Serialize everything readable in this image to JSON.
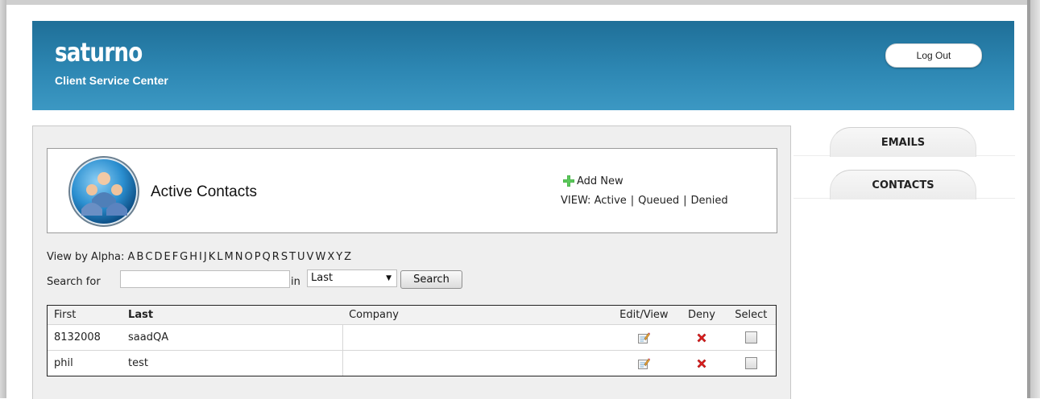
{
  "header": {
    "logo": "saturno",
    "subtitle": "Client Service Center",
    "logout_label": "Log Out"
  },
  "tabs": [
    {
      "label": "EMAILS"
    },
    {
      "label": "CONTACTS"
    }
  ],
  "contacts_panel": {
    "title": "Active Contacts",
    "add_new_label": "Add New",
    "view_label": "VIEW:",
    "view_options": [
      "Active",
      "Queued",
      "Denied"
    ]
  },
  "alpha": {
    "label": "View by Alpha:",
    "letters": [
      "A",
      "B",
      "C",
      "D",
      "E",
      "F",
      "G",
      "H",
      "I",
      "J",
      "K",
      "L",
      "M",
      "N",
      "O",
      "P",
      "Q",
      "R",
      "S",
      "T",
      "U",
      "V",
      "W",
      "X",
      "Y",
      "Z"
    ]
  },
  "search": {
    "label": "Search for",
    "value": "",
    "in_label": "in",
    "field_selected": "Last",
    "button_label": "Search"
  },
  "table": {
    "headers": [
      "First",
      "Last",
      "Company",
      "Edit/View",
      "Deny",
      "Select"
    ],
    "rows": [
      {
        "first": "8132008",
        "last": "saadQA",
        "company": ""
      },
      {
        "first": "phil",
        "last": "test",
        "company": ""
      }
    ]
  },
  "colors": {
    "header_blue": "#2d87b3",
    "deny_red": "#e02020",
    "add_green": "#3aa63a"
  }
}
